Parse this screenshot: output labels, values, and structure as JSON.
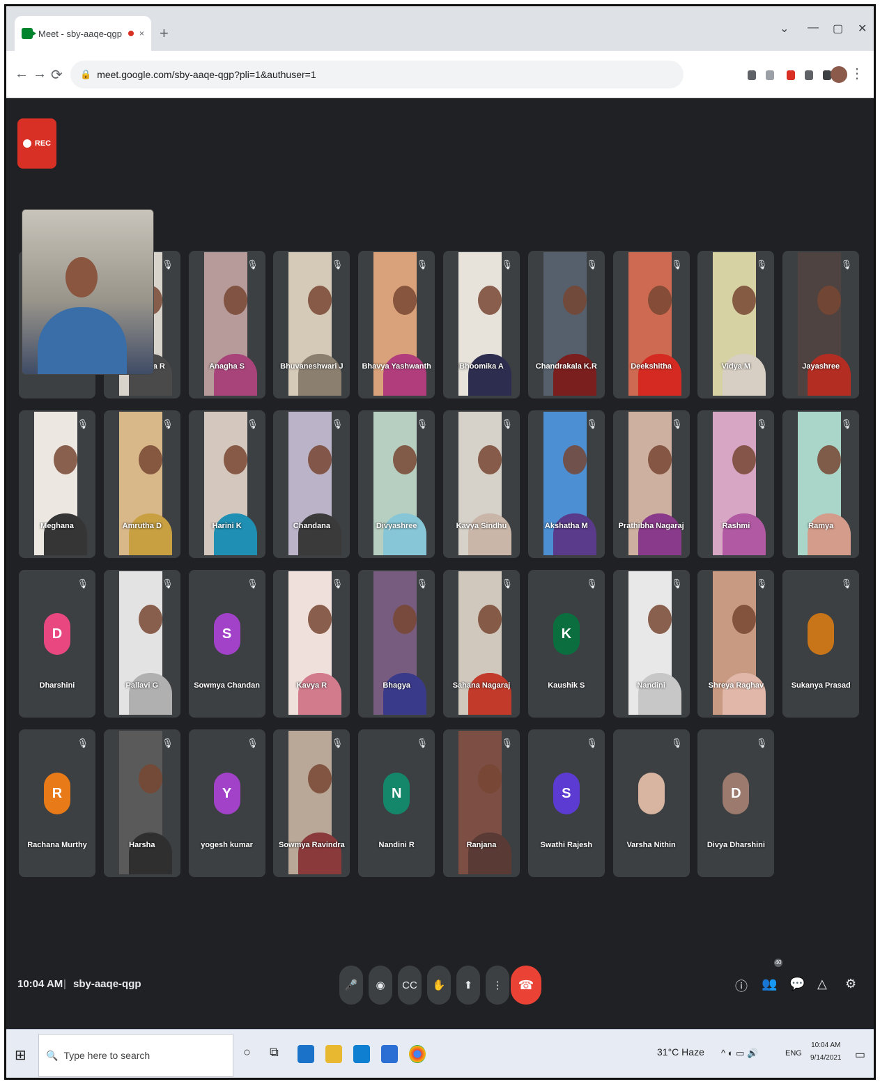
{
  "browser": {
    "tab_title": "Meet - sby-aaqe-qgp",
    "tab_close": "×",
    "new_tab": "+",
    "window_controls": [
      "⌄",
      "—",
      "▢",
      "✕"
    ],
    "nav": [
      "←",
      "→",
      "⟳"
    ],
    "lock_icon": "lock-icon",
    "url": "meet.google.com/sby-aaqe-qgp?pli=1&authuser=1"
  },
  "meet": {
    "recording_label": "REC",
    "self_view": {
      "name": ""
    },
    "tiles": [
      {
        "name": "",
        "video": "#3c4043",
        "type": "hidden"
      },
      {
        "name": "Aishwarya R",
        "video": "#d8d4cc",
        "shirt": "#4a4a4a"
      },
      {
        "name": "Anagha S",
        "video": "#b79a9a",
        "shirt": "#a9447a"
      },
      {
        "name": "Bhuvaneshwari J",
        "video": "#d5c9b8",
        "shirt": "#8b7f70"
      },
      {
        "name": "Bhavya Yashwanth",
        "video": "#d9a27a",
        "shirt": "#b13d7c"
      },
      {
        "name": "Bhoomika A",
        "video": "#e7e2da",
        "shirt": "#2d2d4f"
      },
      {
        "name": "Chandrakala K.R",
        "video": "#55606c",
        "shirt": "#7a1e1e"
      },
      {
        "name": "Deekshitha",
        "video": "#cf6a52",
        "shirt": "#d42a22"
      },
      {
        "name": "Vidya M",
        "video": "#d6d2a4",
        "shirt": "#d8cfc4"
      },
      {
        "name": "Jayashree",
        "video": "#4e4340",
        "shirt": "#b32d22"
      },
      {
        "name": "Meghana",
        "video": "#ece8e1",
        "shirt": "#353535"
      },
      {
        "name": "Amrutha D",
        "video": "#d8b889",
        "shirt": "#c8a042"
      },
      {
        "name": "Harini K",
        "video": "#d4c7bd",
        "shirt": "#1f8fb3"
      },
      {
        "name": "Chandana",
        "video": "#bbb4c8",
        "shirt": "#3a3a3a"
      },
      {
        "name": "Divyashree",
        "video": "#b6cfc0",
        "shirt": "#86c6d6"
      },
      {
        "name": "Kavya Sindhu",
        "video": "#d6d2c9",
        "shirt": "#c9b6a8"
      },
      {
        "name": "Akshatha M",
        "video": "#4c8fd3",
        "shirt": "#5a3a8a"
      },
      {
        "name": "Prathibha Nagaraj",
        "video": "#cdb0a0",
        "shirt": "#8a3a8a"
      },
      {
        "name": "Rashmi",
        "video": "#d8a6c5",
        "shirt": "#b15aa3"
      },
      {
        "name": "Ramya",
        "video": "#a9d6c8",
        "shirt": "#d49c8a"
      },
      {
        "name": "Dharshini",
        "avatar": "D",
        "color": "#e8477f",
        "type": "avatar"
      },
      {
        "name": "Pallavi G",
        "video": "#e3e3e3",
        "shirt": "#b0b0b0"
      },
      {
        "name": "Sowmya Chandan",
        "avatar": "S",
        "color": "#a142c9",
        "type": "avatar"
      },
      {
        "name": "Kavya R",
        "video": "#efe0dc",
        "shirt": "#d27b8c"
      },
      {
        "name": "Bhagya",
        "video": "#785c80",
        "shirt": "#3a3a8a"
      },
      {
        "name": "Sahana Nagaraj",
        "video": "#d0c8bd",
        "shirt": "#c23a2a"
      },
      {
        "name": "Kaushik S",
        "avatar": "K",
        "color": "#0b6e3f",
        "type": "avatar"
      },
      {
        "name": "Nandini",
        "video": "#e8e8e8",
        "shirt": "#c7c7c7"
      },
      {
        "name": "Shreya Raghav",
        "video": "#c99a82",
        "shirt": "#e0b7a8"
      },
      {
        "name": "Sukanya Prasad",
        "avatar": "",
        "color": "#c8751a",
        "type": "avatar"
      },
      {
        "name": "Rachana Murthy",
        "avatar": "R",
        "color": "#e87a17",
        "type": "avatar"
      },
      {
        "name": "Harsha",
        "video": "#5a5a5a",
        "shirt": "#2f2f2f"
      },
      {
        "name": "yogesh kumar",
        "avatar": "Y",
        "color": "#a142c9",
        "type": "avatar"
      },
      {
        "name": "Sowmya Ravindra",
        "video": "#b9a797",
        "shirt": "#8a3a3a"
      },
      {
        "name": "Nandini R",
        "avatar": "N",
        "color": "#14876b",
        "type": "avatar"
      },
      {
        "name": "Ranjana",
        "video": "#7c4e44",
        "shirt": "#5a3a34"
      },
      {
        "name": "Swathi Rajesh",
        "avatar": "S",
        "color": "#5b3bd1",
        "type": "avatar"
      },
      {
        "name": "Varsha Nithin",
        "avatar": "",
        "color": "#d8b5a0",
        "type": "avatar"
      },
      {
        "name": "Divya Dharshini",
        "avatar": "D",
        "color": "#9c7b6e",
        "type": "avatar"
      }
    ]
  },
  "controls": {
    "time": "10:04 AM",
    "separator": "|",
    "meeting_code": "sby-aaqe-qgp",
    "buttons": [
      "🎤",
      "◉",
      "CC",
      "✋",
      "⬆",
      "⋮"
    ],
    "hangup": "☎",
    "right_buttons": [
      "ⓘ",
      "👥",
      "💬",
      "△",
      "⚙"
    ],
    "people_count": "40"
  },
  "taskbar": {
    "start": "⊞",
    "search_placeholder": "Type here to search",
    "search_icon": "🔍",
    "cortana": "○",
    "task_view": "⧉",
    "weather": "31°C  Haze",
    "tray": "^ ◐ ▭ 🔊",
    "lang": "ENG",
    "time": "10:04 AM",
    "date": "9/14/2021",
    "notification": "▭"
  }
}
